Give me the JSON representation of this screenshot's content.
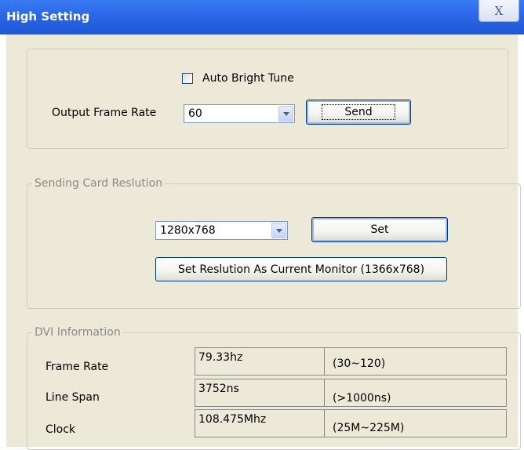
{
  "window": {
    "title": "High Setting",
    "close_label": "X"
  },
  "frame_rate_panel": {
    "auto_bright_label": "Auto Bright Tune",
    "auto_bright_checked": false,
    "output_label": "Output Frame Rate",
    "output_value": "60",
    "send_label": "Send"
  },
  "resolution_panel": {
    "legend": "Sending Card Reslution",
    "resolution_value": "1280x768",
    "set_label": "Set",
    "set_current_label": "Set Reslution As Current Monitor (1366x768)"
  },
  "dvi_panel": {
    "legend": "DVI Information",
    "rows": [
      {
        "label": "Frame Rate",
        "value": "79.33hz",
        "range": "(30~120)"
      },
      {
        "label": "Line Span",
        "value": "3752ns",
        "range": "(>1000ns)"
      },
      {
        "label": "Clock",
        "value": "108.475Mhz",
        "range": "(25M~225M)"
      }
    ]
  }
}
